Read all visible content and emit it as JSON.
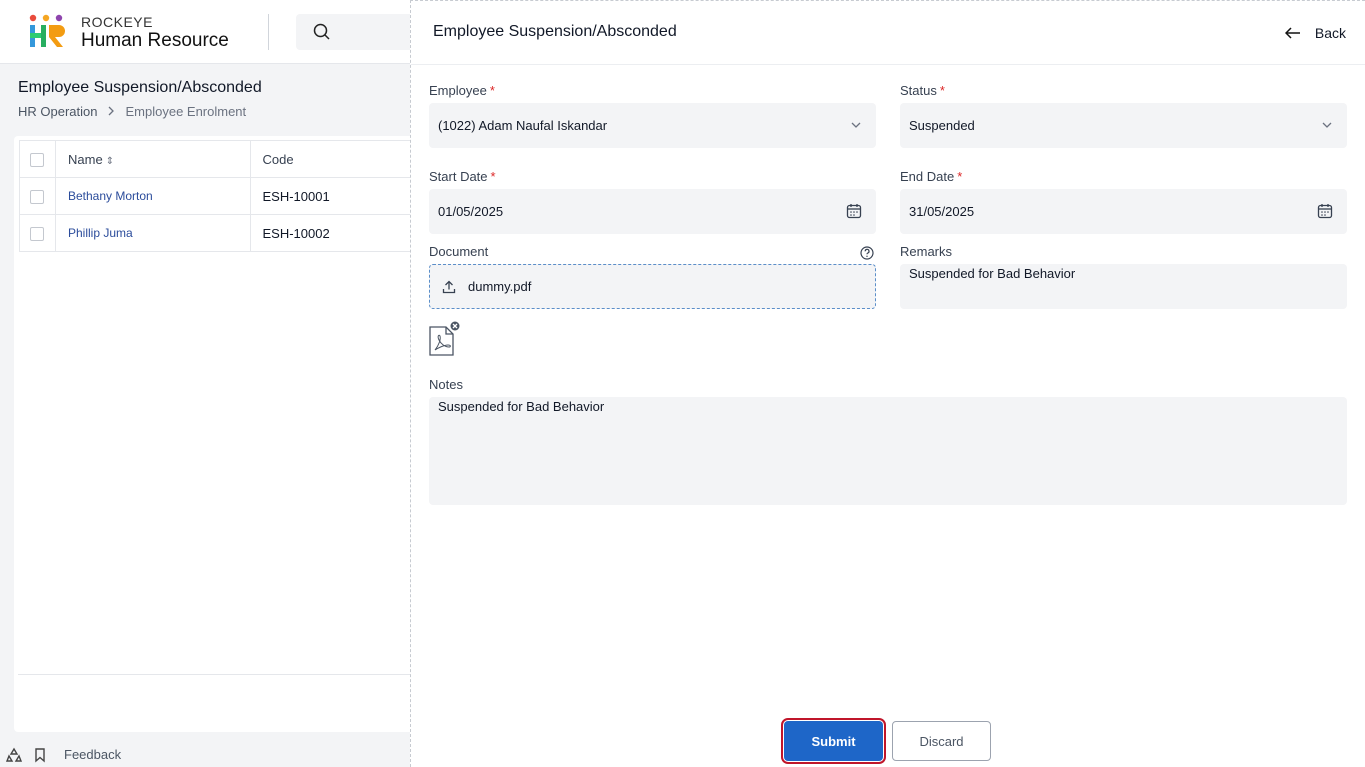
{
  "app": {
    "brand_small": "ROCKEYE",
    "brand_big": "Human Resource"
  },
  "page": {
    "title": "Employee Suspension/Absconded",
    "breadcrumb": [
      "HR Operation",
      "Employee Enrolment"
    ]
  },
  "table": {
    "headers": {
      "name": "Name",
      "code": "Code"
    },
    "rows": [
      {
        "name": "Bethany Morton",
        "code": "ESH-10001"
      },
      {
        "name": "Phillip Juma",
        "code": "ESH-10002"
      }
    ]
  },
  "bottom": {
    "feedback": "Feedback"
  },
  "drawer": {
    "title": "Employee Suspension/Absconded",
    "back_label": "Back",
    "employee": {
      "label": "Employee",
      "value": "(1022) Adam Naufal Iskandar"
    },
    "status": {
      "label": "Status",
      "value": "Suspended"
    },
    "start_date": {
      "label": "Start Date",
      "value": "01/05/2025"
    },
    "end_date": {
      "label": "End Date",
      "value": "31/05/2025"
    },
    "document": {
      "label": "Document",
      "file": "dummy.pdf"
    },
    "remarks": {
      "label": "Remarks",
      "value": "Suspended for Bad Behavior"
    },
    "notes": {
      "label": "Notes",
      "value": "Suspended for Bad Behavior"
    },
    "required_mark": "*",
    "submit_label": "Submit",
    "discard_label": "Discard"
  },
  "colors": {
    "primary": "#1e66c8",
    "link": "#2b4c9b",
    "required": "#dc2626"
  }
}
